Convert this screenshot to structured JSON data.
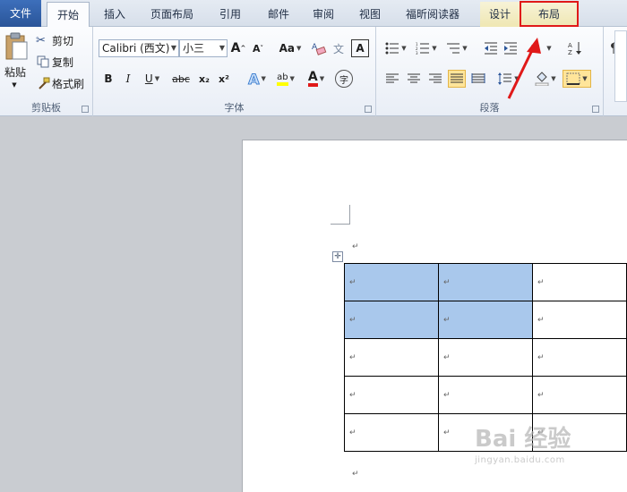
{
  "tabs": {
    "file": "文件",
    "home": "开始",
    "insert": "插入",
    "page_layout": "页面布局",
    "references": "引用",
    "mailings": "邮件",
    "review": "审阅",
    "view": "视图",
    "foxit": "福昕阅读器",
    "design": "设计",
    "layout": "布局"
  },
  "clipboard": {
    "paste": "粘贴",
    "cut": "剪切",
    "copy": "复制",
    "format_painter": "格式刷",
    "label": "剪贴板"
  },
  "font": {
    "font_name": "Calibri (西文)",
    "font_size": "小三",
    "grow": "A",
    "shrink": "A",
    "change_case": "Aa",
    "phonetic": "文",
    "bold": "B",
    "italic": "I",
    "underline": "U",
    "strike": "abc",
    "subscript": "x₂",
    "superscript": "x²",
    "text_effect": "A",
    "highlight": "ab",
    "font_color": "A",
    "label": "字体"
  },
  "paragraph": {
    "label": "段落"
  },
  "document": {
    "para_mark": "↵",
    "table_rows": [
      [
        "↵",
        "↵",
        "↵"
      ],
      [
        "↵",
        "↵",
        "↵"
      ],
      [
        "↵",
        "↵",
        "↵"
      ],
      [
        "↵",
        "↵",
        "↵"
      ],
      [
        "↵",
        "↵",
        "↵"
      ]
    ]
  },
  "watermark": {
    "text": "Bai 经验",
    "url": "jingyan.baidu.com"
  },
  "colors": {
    "accent": "#2a5599",
    "selection": "#a9c8ec",
    "highlight_box": "#e01919"
  }
}
